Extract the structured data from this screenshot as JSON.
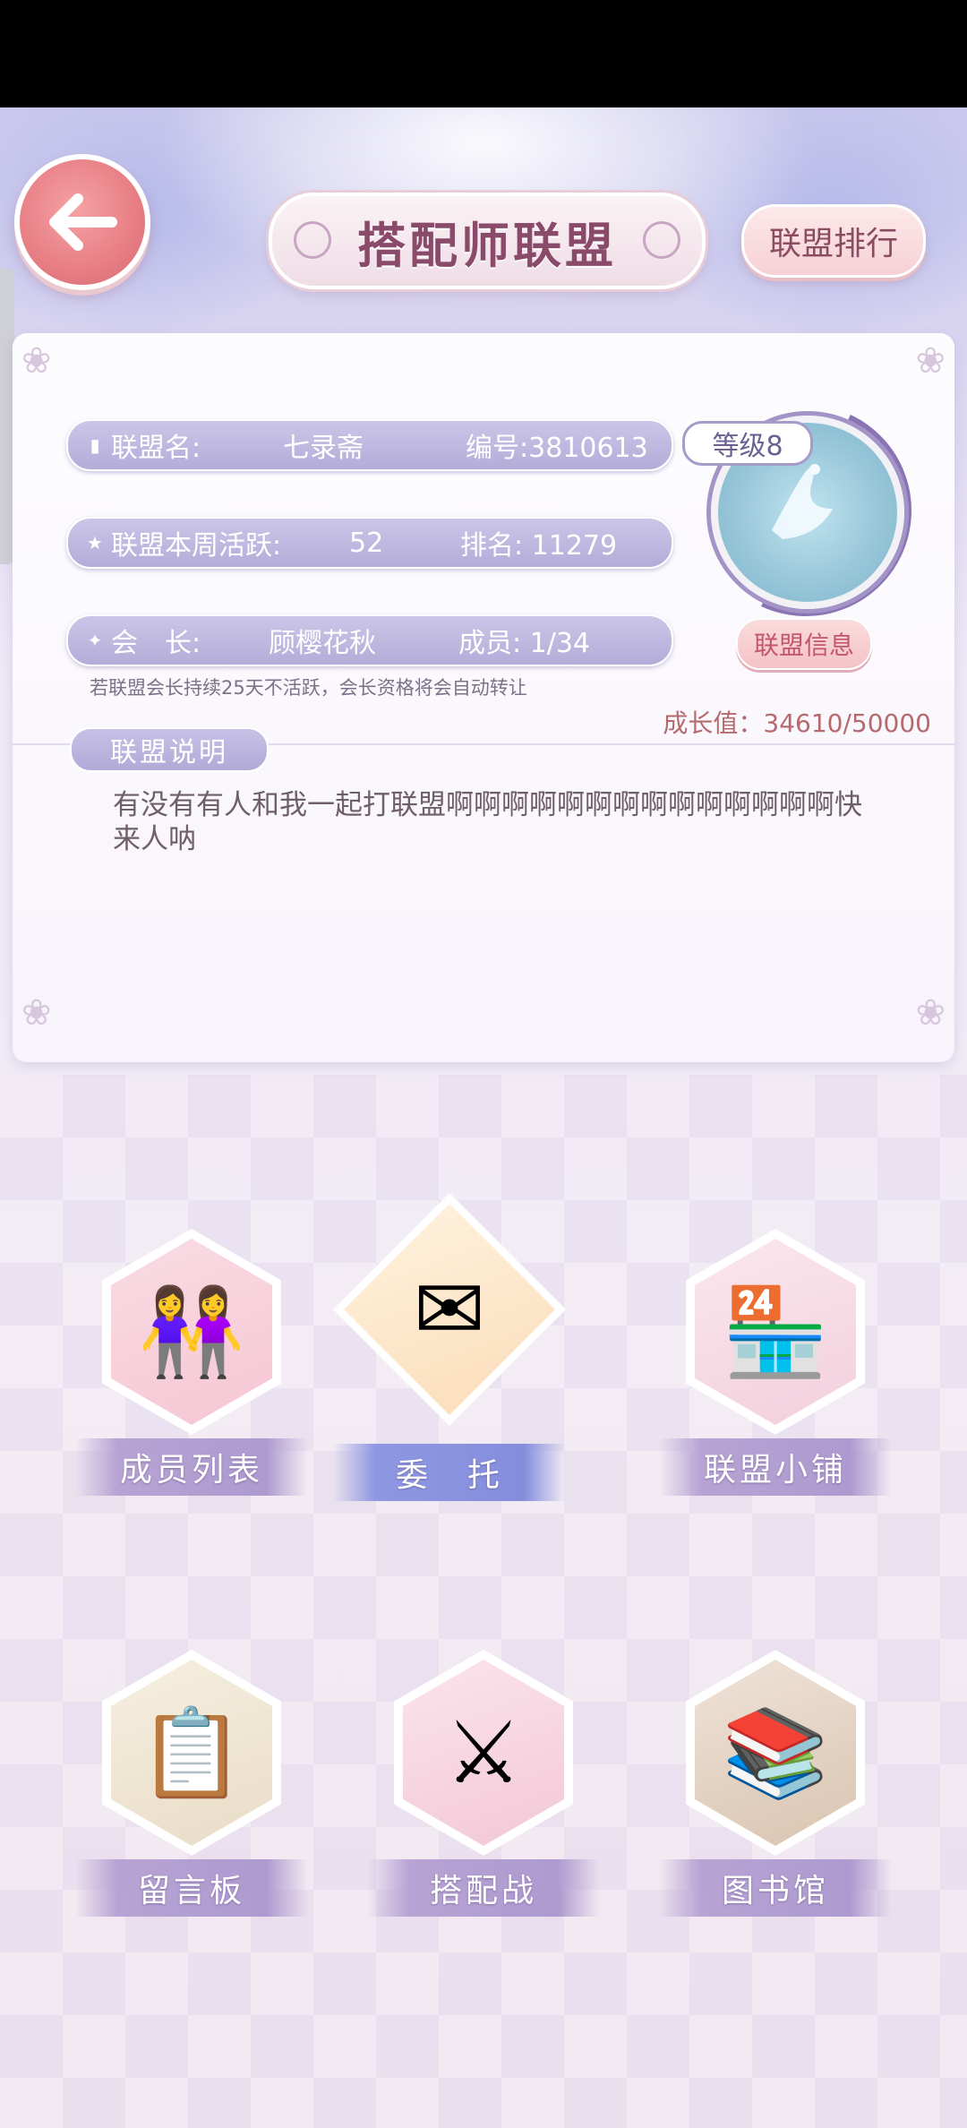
{
  "header": {
    "title": "搭配师联盟",
    "ranking_button": "联盟排行"
  },
  "alliance": {
    "name_label": "联盟名:",
    "name": "七录斋",
    "id_text": "编号:3810613",
    "level": "等级8",
    "activity_label": "联盟本周活跃:",
    "activity": "52",
    "rank_text": "排名: 11279",
    "leader_label": "会　长:",
    "leader": "顾樱花秋",
    "members_text": "成员: 1/34",
    "info_button": "联盟信息",
    "notice": "若联盟会长持续25天不活跃，会长资格将会自动转让",
    "growth_text": "成长值：34610/50000"
  },
  "description": {
    "section_title": "联盟说明",
    "text": "有没有有人和我一起打联盟啊啊啊啊啊啊啊啊啊啊啊啊啊啊快来人呐"
  },
  "menu": [
    {
      "label": "成员列表",
      "icon": "members-icon"
    },
    {
      "label": "委　托",
      "icon": "commission-icon"
    },
    {
      "label": "联盟小铺",
      "icon": "shop-icon"
    },
    {
      "label": "留言板",
      "icon": "message-board-icon"
    },
    {
      "label": "搭配战",
      "icon": "styling-battle-icon"
    },
    {
      "label": "图书馆",
      "icon": "library-icon"
    }
  ]
}
